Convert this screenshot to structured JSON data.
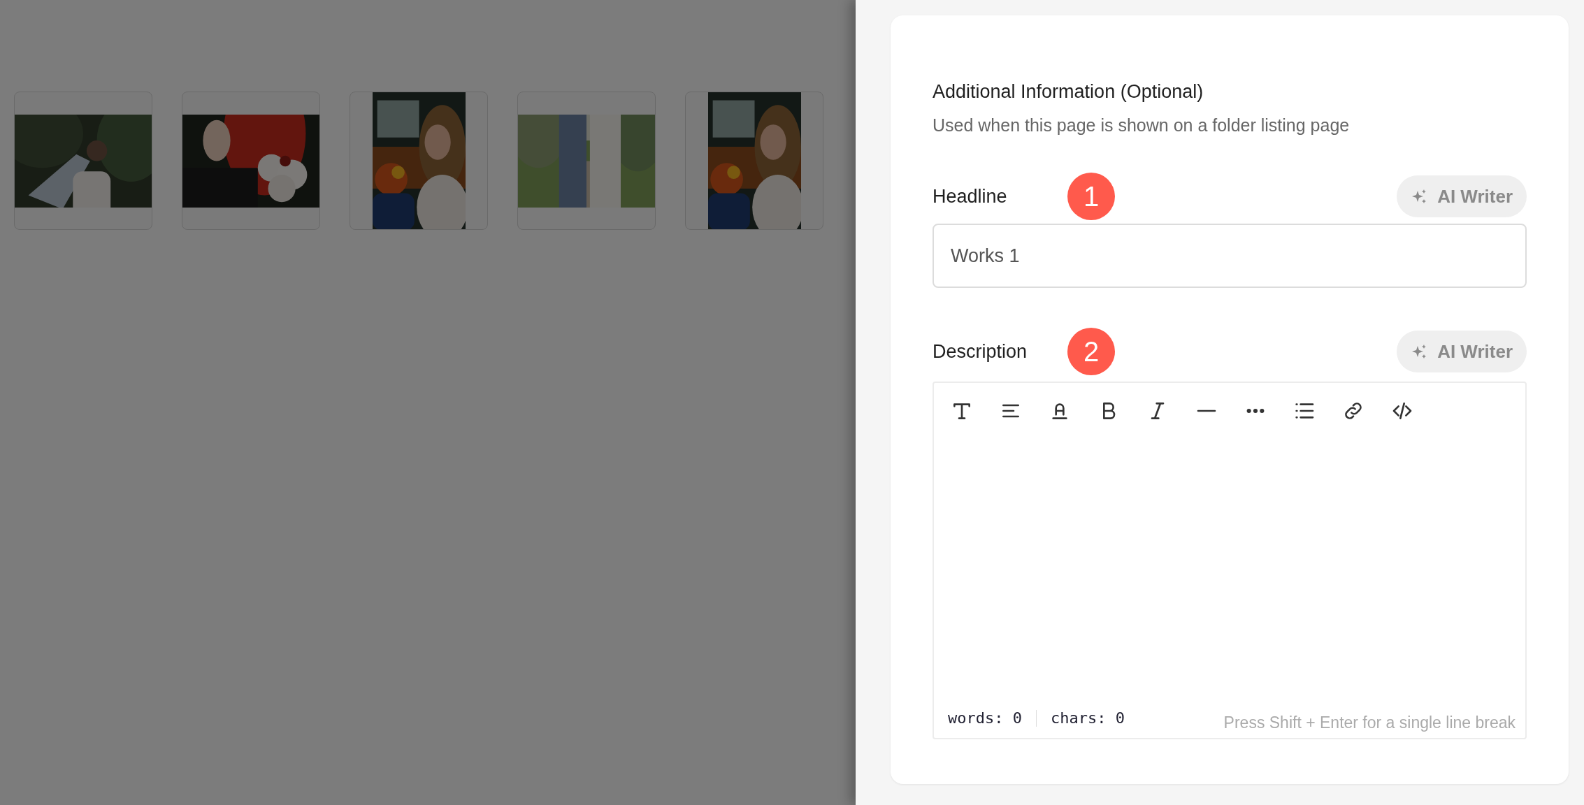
{
  "panel": {
    "title": "Additional Information (Optional)",
    "subtitle": "Used when this page is shown on a folder listing page",
    "headline": {
      "label": "Headline",
      "marker": "1",
      "ai_button": "AI Writer",
      "value": "Works 1"
    },
    "description": {
      "label": "Description",
      "marker": "2",
      "ai_button": "AI Writer",
      "words": "words: 0",
      "chars": "chars: 0",
      "hint": "Press Shift + Enter for a single line break"
    }
  }
}
